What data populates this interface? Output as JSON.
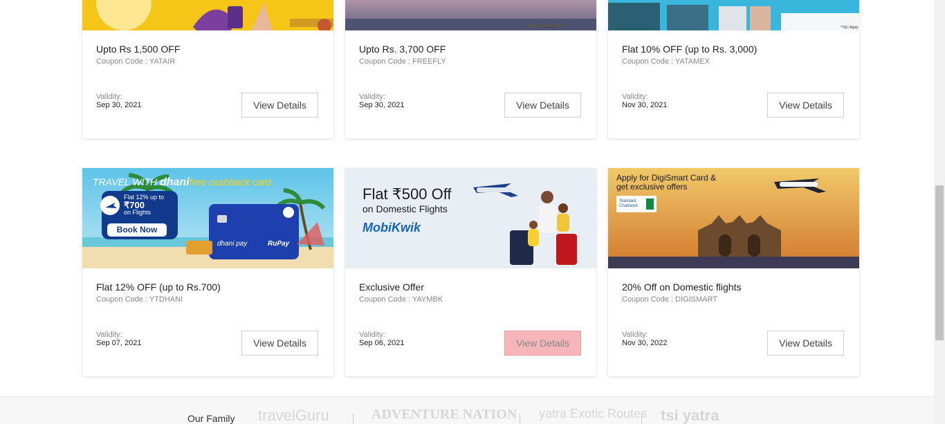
{
  "offers": [
    {
      "title": "Upto Rs 1,500 OFF",
      "coupon": "Coupon Code : YATAIR",
      "validity_label": "Validity:",
      "validity_date": "Sep 30, 2021",
      "button": "View Details"
    },
    {
      "title": "Upto Rs. 3,700 OFF",
      "coupon": "Coupon Code : FREEFLY",
      "validity_label": "Validity:",
      "validity_date": "Sep 30, 2021",
      "button": "View Details"
    },
    {
      "title": "Flat 10% OFF (up to Rs. 3,000)",
      "coupon": "Coupon Code : YATAMEX",
      "validity_label": "Validity:",
      "validity_date": "Nov 30, 2021",
      "button": "View Details",
      "banner_note": "*T&C Apply"
    },
    {
      "title": "Flat 12% OFF (up to Rs.700)",
      "coupon": "Coupon Code : YTDHANI",
      "validity_label": "Validity:",
      "validity_date": "Sep 07, 2021",
      "button": "View Details",
      "banner": {
        "headline_a": "TRAVEL WITH",
        "headline_brand": "dhani",
        "headline_b": "free cashback card",
        "badge_line1": "Flat 12% up to",
        "badge_line2": "₹700",
        "badge_line3": "on Flights",
        "cta": "Book Now",
        "card_brand": "dhani pay",
        "card_network": "RuPay"
      }
    },
    {
      "title": "Exclusive Offer",
      "coupon": "Coupon Code : YAYMBK",
      "validity_label": "Validity:",
      "validity_date": "Sep 06, 2021",
      "button": "View Details",
      "banner": {
        "headline": "Flat ₹500 Off",
        "sub": "on Domestic Flights",
        "brand": "MobiKwik"
      }
    },
    {
      "title": "20% Off on Domestic flights",
      "coupon": "Coupon Code : DIGISMART",
      "validity_label": "Validity:",
      "validity_date": "Nov 30, 2022",
      "button": "View Details",
      "banner": {
        "line1": "Apply for DigiSmart Card &",
        "line2": "get exclusive offers",
        "bank_line1": "Standard",
        "bank_line2": "Chartered"
      }
    }
  ],
  "footer": {
    "label": "Our Family",
    "logos": [
      "travelGuru",
      "ADVENTURE NATION",
      "yatra Exotic Routes",
      "tsi yatra"
    ]
  },
  "colors": {
    "hover_button": "#f6b6b9",
    "banner_yellow": "#f5c518",
    "mobikwik_blue": "#1565c0"
  }
}
